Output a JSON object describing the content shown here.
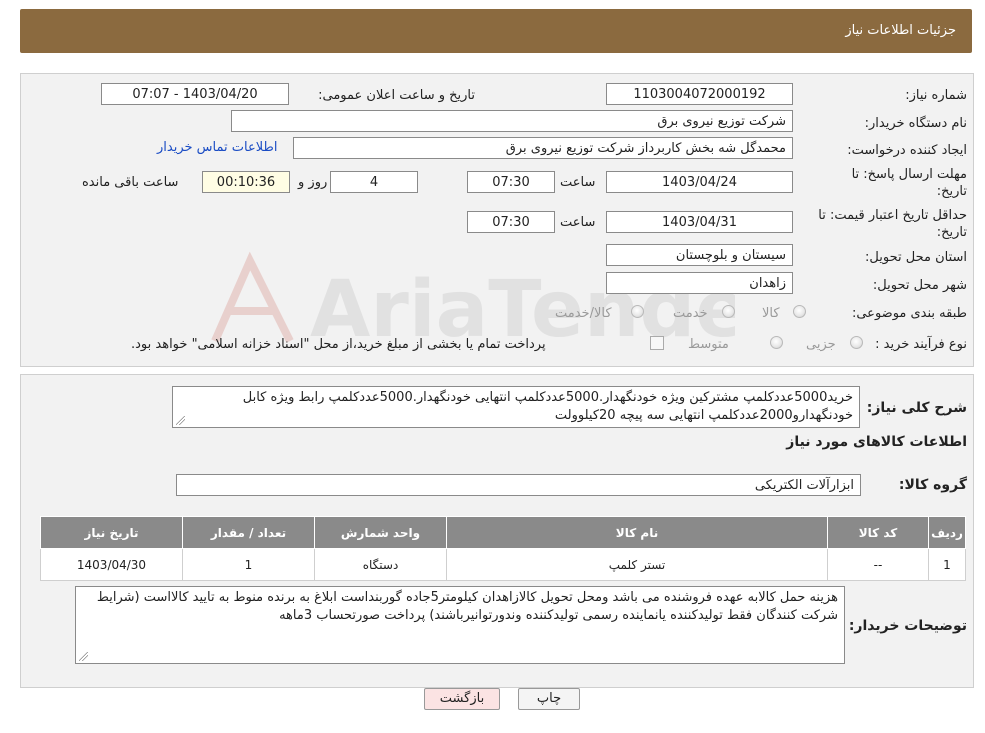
{
  "header": {
    "title": "جزئیات اطلاعات نیاز"
  },
  "form": {
    "need_number_label": "شماره نیاز:",
    "need_number": "1103004072000192",
    "announce_label": "تاریخ و ساعت اعلان عمومی:",
    "announce_value": "1403/04/20 - 07:07",
    "buyer_org_label": "نام دستگاه خریدار:",
    "buyer_org": "شرکت توزیع نیروی برق",
    "requester_label": "ایجاد کننده درخواست:",
    "requester": "محمدگل شه بخش کاربرداز شرکت توزیع نیروی برق",
    "contact_link": "اطلاعات تماس خریدار",
    "deadline_label_1": "مهلت ارسال پاسخ: تا",
    "deadline_label_2": "تاریخ:",
    "deadline_date": "1403/04/24",
    "time_label": "ساعت",
    "deadline_time": "07:30",
    "days_value": "4",
    "days_label": "روز و",
    "remaining_value": "00:10:36",
    "remaining_label": "ساعت باقی مانده",
    "validity_label_1": "حداقل تاریخ اعتبار قیمت: تا",
    "validity_label_2": "تاریخ:",
    "validity_date": "1403/04/31",
    "validity_time": "07:30",
    "province_label": "استان محل تحویل:",
    "province": "سیستان و بلوچستان",
    "city_label": "شهر محل تحویل:",
    "city": "زاهدان",
    "category_label": "طبقه بندی موضوعی:",
    "category_options": [
      "کالا",
      "خدمت",
      "کالا/خدمت"
    ],
    "process_label": "نوع فرآیند خرید :",
    "process_options": [
      "جزیی",
      "متوسط"
    ],
    "process_note": "پرداخت تمام یا بخشی از مبلغ خرید،از محل \"اسناد خزانه اسلامی\" خواهد بود."
  },
  "description": {
    "label": "شرح کلی نیاز:",
    "text": "خرید5000عددکلمپ مشترکین ویژه  خودنگهدار.5000عددکلمپ انتهایی خودنگهدار.5000عددکلمپ رابط ویژه کابل خودنگهدارو2000عددکلمپ انتهایی سه پیچه 20کیلوولت"
  },
  "goods": {
    "section_title": "اطلاعات کالاهای مورد نیاز",
    "group_label": "گروه کالا:",
    "group_value": "ابزارآلات الکتریکی",
    "columns": [
      "ردیف",
      "کد کالا",
      "نام کالا",
      "واحد شمارش",
      "تعداد / مقدار",
      "تاریخ نیاز"
    ],
    "rows": [
      [
        "1",
        "--",
        "تستر کلمپ",
        "دستگاه",
        "1",
        "1403/04/30"
      ]
    ]
  },
  "buyer_notes": {
    "label": "توضیحات خریدار:",
    "text": "هزینه حمل کالابه عهده فروشنده می باشد ومحل تحویل کالازاهدان کیلومتر5جاده گوربنداست ابلاغ به برنده منوط به تایید کالااست (شرایط شرکت کنندگان فقط تولیدکننده یانماینده رسمی تولیدکننده وندورتوانیرباشند) پرداخت صورتحساب 3ماهه"
  },
  "buttons": {
    "print": "چاپ",
    "back": "بازگشت"
  },
  "watermark": {
    "text": "AriaTender.neT"
  },
  "colors": {
    "header": "#8b6a3f",
    "link": "#1a4cc4",
    "table_header": "#8a8a8a",
    "back_button": "#fbe3e3"
  }
}
